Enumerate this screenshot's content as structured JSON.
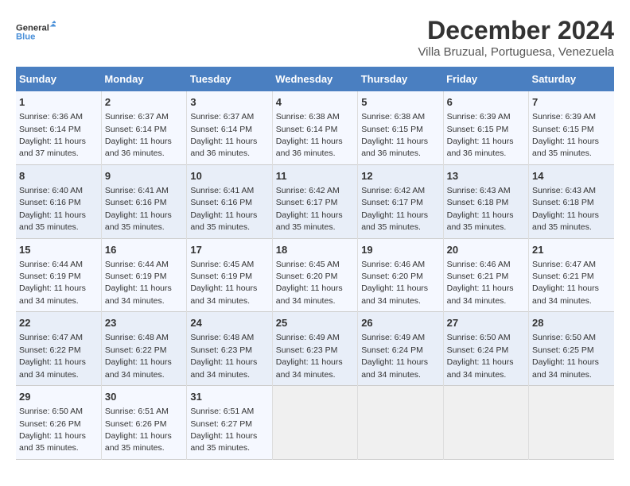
{
  "logo": {
    "line1": "General",
    "line2": "Blue"
  },
  "title": "December 2024",
  "subtitle": "Villa Bruzual, Portuguesa, Venezuela",
  "days_of_week": [
    "Sunday",
    "Monday",
    "Tuesday",
    "Wednesday",
    "Thursday",
    "Friday",
    "Saturday"
  ],
  "weeks": [
    [
      {
        "day": "1",
        "sunrise": "Sunrise: 6:36 AM",
        "sunset": "Sunset: 6:14 PM",
        "daylight": "Daylight: 11 hours and 37 minutes."
      },
      {
        "day": "2",
        "sunrise": "Sunrise: 6:37 AM",
        "sunset": "Sunset: 6:14 PM",
        "daylight": "Daylight: 11 hours and 36 minutes."
      },
      {
        "day": "3",
        "sunrise": "Sunrise: 6:37 AM",
        "sunset": "Sunset: 6:14 PM",
        "daylight": "Daylight: 11 hours and 36 minutes."
      },
      {
        "day": "4",
        "sunrise": "Sunrise: 6:38 AM",
        "sunset": "Sunset: 6:14 PM",
        "daylight": "Daylight: 11 hours and 36 minutes."
      },
      {
        "day": "5",
        "sunrise": "Sunrise: 6:38 AM",
        "sunset": "Sunset: 6:15 PM",
        "daylight": "Daylight: 11 hours and 36 minutes."
      },
      {
        "day": "6",
        "sunrise": "Sunrise: 6:39 AM",
        "sunset": "Sunset: 6:15 PM",
        "daylight": "Daylight: 11 hours and 36 minutes."
      },
      {
        "day": "7",
        "sunrise": "Sunrise: 6:39 AM",
        "sunset": "Sunset: 6:15 PM",
        "daylight": "Daylight: 11 hours and 35 minutes."
      }
    ],
    [
      {
        "day": "8",
        "sunrise": "Sunrise: 6:40 AM",
        "sunset": "Sunset: 6:16 PM",
        "daylight": "Daylight: 11 hours and 35 minutes."
      },
      {
        "day": "9",
        "sunrise": "Sunrise: 6:41 AM",
        "sunset": "Sunset: 6:16 PM",
        "daylight": "Daylight: 11 hours and 35 minutes."
      },
      {
        "day": "10",
        "sunrise": "Sunrise: 6:41 AM",
        "sunset": "Sunset: 6:16 PM",
        "daylight": "Daylight: 11 hours and 35 minutes."
      },
      {
        "day": "11",
        "sunrise": "Sunrise: 6:42 AM",
        "sunset": "Sunset: 6:17 PM",
        "daylight": "Daylight: 11 hours and 35 minutes."
      },
      {
        "day": "12",
        "sunrise": "Sunrise: 6:42 AM",
        "sunset": "Sunset: 6:17 PM",
        "daylight": "Daylight: 11 hours and 35 minutes."
      },
      {
        "day": "13",
        "sunrise": "Sunrise: 6:43 AM",
        "sunset": "Sunset: 6:18 PM",
        "daylight": "Daylight: 11 hours and 35 minutes."
      },
      {
        "day": "14",
        "sunrise": "Sunrise: 6:43 AM",
        "sunset": "Sunset: 6:18 PM",
        "daylight": "Daylight: 11 hours and 35 minutes."
      }
    ],
    [
      {
        "day": "15",
        "sunrise": "Sunrise: 6:44 AM",
        "sunset": "Sunset: 6:19 PM",
        "daylight": "Daylight: 11 hours and 34 minutes."
      },
      {
        "day": "16",
        "sunrise": "Sunrise: 6:44 AM",
        "sunset": "Sunset: 6:19 PM",
        "daylight": "Daylight: 11 hours and 34 minutes."
      },
      {
        "day": "17",
        "sunrise": "Sunrise: 6:45 AM",
        "sunset": "Sunset: 6:19 PM",
        "daylight": "Daylight: 11 hours and 34 minutes."
      },
      {
        "day": "18",
        "sunrise": "Sunrise: 6:45 AM",
        "sunset": "Sunset: 6:20 PM",
        "daylight": "Daylight: 11 hours and 34 minutes."
      },
      {
        "day": "19",
        "sunrise": "Sunrise: 6:46 AM",
        "sunset": "Sunset: 6:20 PM",
        "daylight": "Daylight: 11 hours and 34 minutes."
      },
      {
        "day": "20",
        "sunrise": "Sunrise: 6:46 AM",
        "sunset": "Sunset: 6:21 PM",
        "daylight": "Daylight: 11 hours and 34 minutes."
      },
      {
        "day": "21",
        "sunrise": "Sunrise: 6:47 AM",
        "sunset": "Sunset: 6:21 PM",
        "daylight": "Daylight: 11 hours and 34 minutes."
      }
    ],
    [
      {
        "day": "22",
        "sunrise": "Sunrise: 6:47 AM",
        "sunset": "Sunset: 6:22 PM",
        "daylight": "Daylight: 11 hours and 34 minutes."
      },
      {
        "day": "23",
        "sunrise": "Sunrise: 6:48 AM",
        "sunset": "Sunset: 6:22 PM",
        "daylight": "Daylight: 11 hours and 34 minutes."
      },
      {
        "day": "24",
        "sunrise": "Sunrise: 6:48 AM",
        "sunset": "Sunset: 6:23 PM",
        "daylight": "Daylight: 11 hours and 34 minutes."
      },
      {
        "day": "25",
        "sunrise": "Sunrise: 6:49 AM",
        "sunset": "Sunset: 6:23 PM",
        "daylight": "Daylight: 11 hours and 34 minutes."
      },
      {
        "day": "26",
        "sunrise": "Sunrise: 6:49 AM",
        "sunset": "Sunset: 6:24 PM",
        "daylight": "Daylight: 11 hours and 34 minutes."
      },
      {
        "day": "27",
        "sunrise": "Sunrise: 6:50 AM",
        "sunset": "Sunset: 6:24 PM",
        "daylight": "Daylight: 11 hours and 34 minutes."
      },
      {
        "day": "28",
        "sunrise": "Sunrise: 6:50 AM",
        "sunset": "Sunset: 6:25 PM",
        "daylight": "Daylight: 11 hours and 34 minutes."
      }
    ],
    [
      {
        "day": "29",
        "sunrise": "Sunrise: 6:50 AM",
        "sunset": "Sunset: 6:26 PM",
        "daylight": "Daylight: 11 hours and 35 minutes."
      },
      {
        "day": "30",
        "sunrise": "Sunrise: 6:51 AM",
        "sunset": "Sunset: 6:26 PM",
        "daylight": "Daylight: 11 hours and 35 minutes."
      },
      {
        "day": "31",
        "sunrise": "Sunrise: 6:51 AM",
        "sunset": "Sunset: 6:27 PM",
        "daylight": "Daylight: 11 hours and 35 minutes."
      },
      null,
      null,
      null,
      null
    ]
  ]
}
